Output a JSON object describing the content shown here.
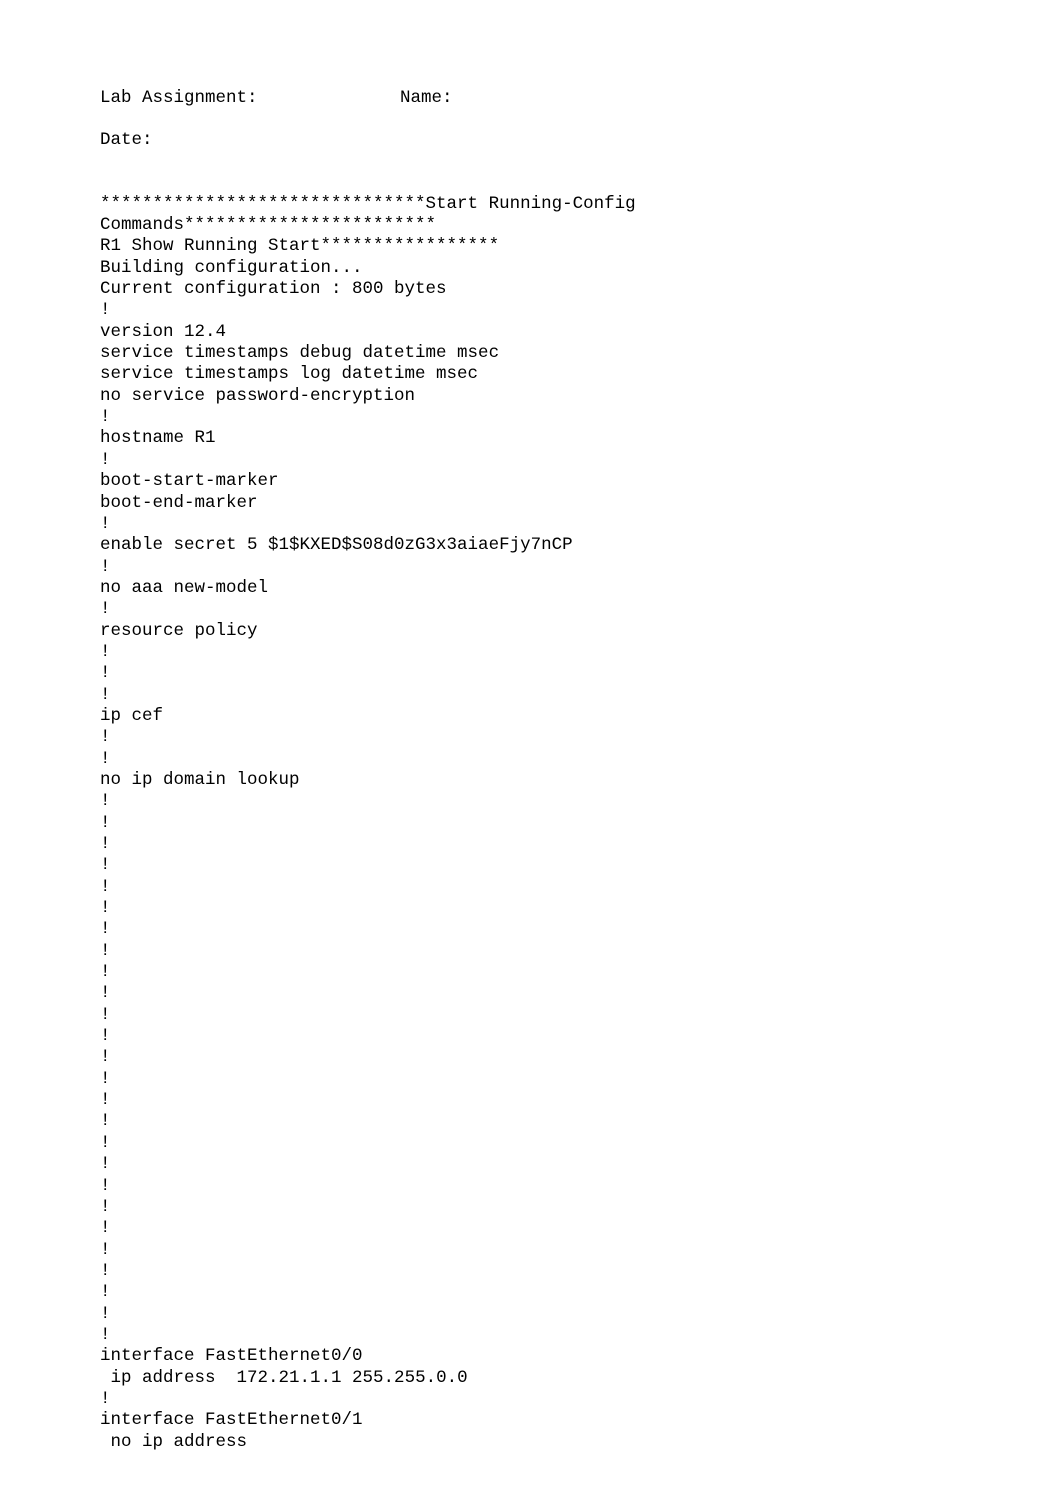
{
  "header": {
    "lab_label": "Lab Assignment:",
    "name_label": "Name:",
    "date_label": "Date:"
  },
  "config_text": "*******************************Start Running-Config Commands************************\nR1 Show Running Start*****************\nBuilding configuration...\nCurrent configuration : 800 bytes\n!\nversion 12.4\nservice timestamps debug datetime msec\nservice timestamps log datetime msec\nno service password-encryption\n!\nhostname R1\n!\nboot-start-marker\nboot-end-marker\n!\nenable secret 5 $1$KXED$S08d0zG3x3aiaeFjy7nCP\n!\nno aaa new-model\n!\nresource policy\n!\n!\n!\nip cef\n!\n!\nno ip domain lookup\n!\n!\n!\n!\n!\n!\n!\n!\n!\n!\n!\n!\n!\n!\n!\n!\n!\n!\n!\n!\n!\n!\n!\n!\n!\n!\ninterface FastEthernet0/0\n ip address  172.21.1.1 255.255.0.0\n!\ninterface FastEthernet0/1\n no ip address"
}
